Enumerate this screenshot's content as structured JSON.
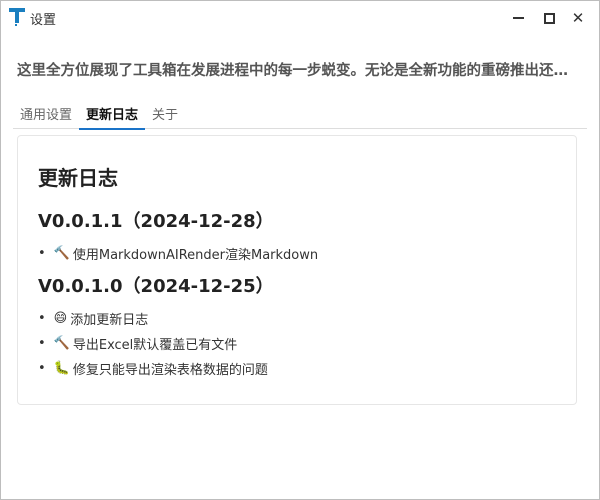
{
  "window": {
    "title": "设置",
    "accent": "#1a73c8"
  },
  "description": "这里全方位展现了工具箱在发展进程中的每一步蜕变。无论是全新功能的重磅推出还是细节之处的优化改进",
  "tabs": [
    {
      "label": "通用设置"
    },
    {
      "label": "更新日志"
    },
    {
      "label": "关于"
    }
  ],
  "changelog": {
    "heading": "更新日志",
    "versions": [
      {
        "title": "V0.0.1.1（2024-12-28）",
        "items": [
          {
            "icon": "hammer",
            "emoji": "🔨",
            "text": "使用MarkdownAIRender渲染Markdown"
          }
        ]
      },
      {
        "title": "V0.0.1.0（2024-12-25）",
        "items": [
          {
            "icon": "smile",
            "emoji": "😄",
            "text": "添加更新日志"
          },
          {
            "icon": "hammer",
            "emoji": "🔨",
            "text": "导出Excel默认覆盖已有文件"
          },
          {
            "icon": "bug",
            "emoji": "🐛",
            "text": "修复只能导出渲染表格数据的问题"
          }
        ]
      }
    ]
  }
}
